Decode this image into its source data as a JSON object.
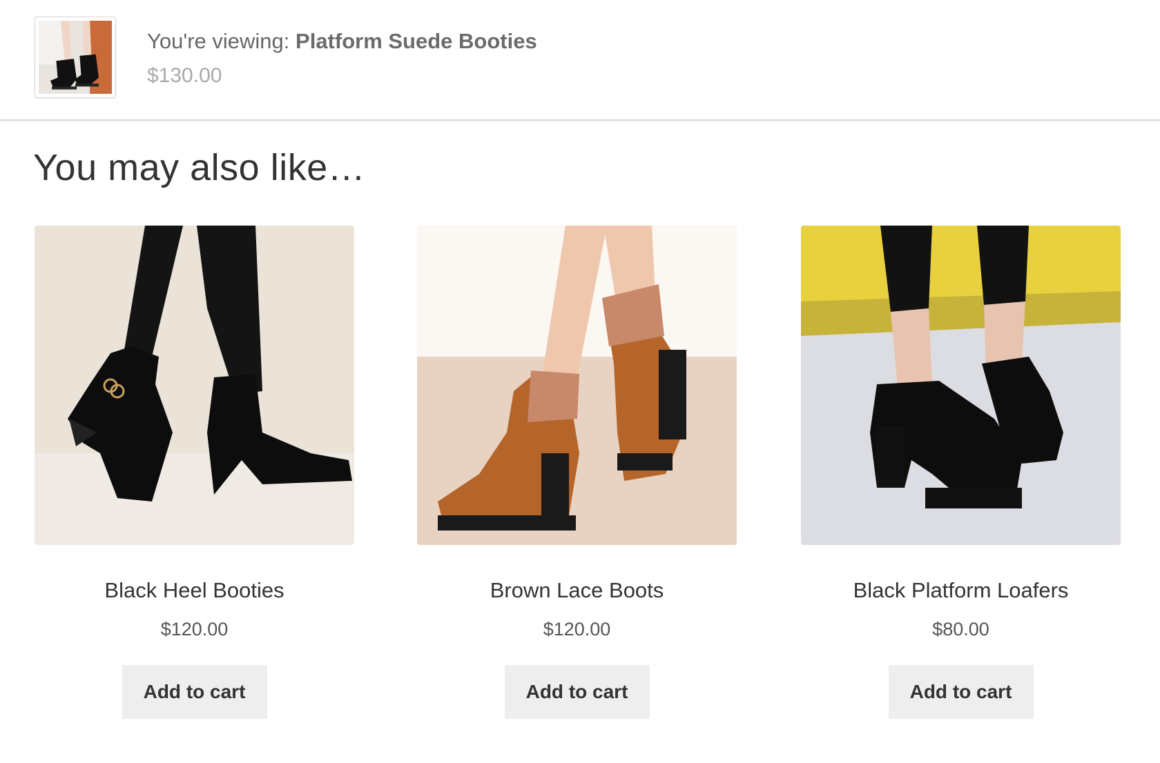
{
  "viewing": {
    "prefix": "You're viewing: ",
    "product_name": "Platform Suede Booties",
    "price": "$130.00"
  },
  "related": {
    "title": "You may also like…",
    "products": [
      {
        "name": "Black Heel Booties",
        "price": "$120.00",
        "button": "Add to cart"
      },
      {
        "name": "Brown Lace Boots",
        "price": "$120.00",
        "button": "Add to cart"
      },
      {
        "name": "Black Platform Loafers",
        "price": "$80.00",
        "button": "Add to cart"
      }
    ]
  },
  "colors": {
    "button_bg": "#eeeeee",
    "text": "#333333",
    "price_muted": "#a9a9a9"
  }
}
